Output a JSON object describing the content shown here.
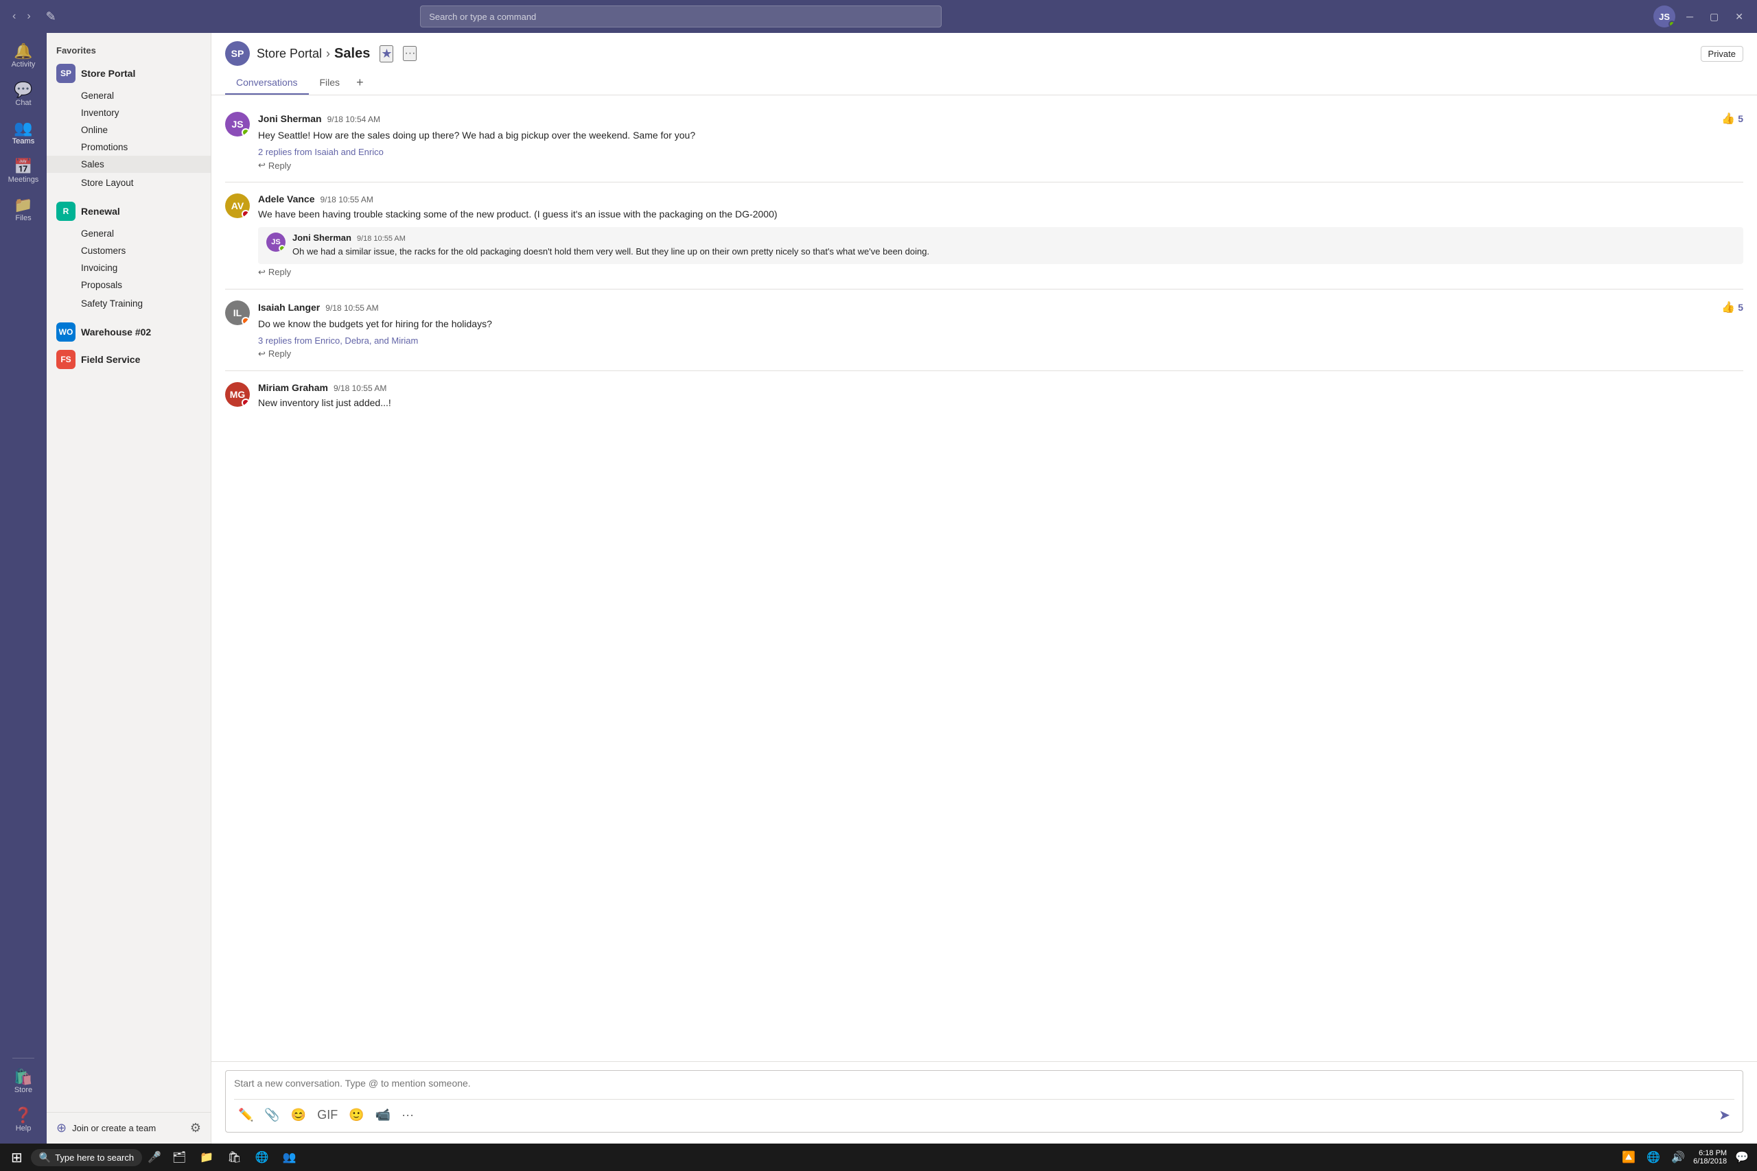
{
  "topbar": {
    "search_placeholder": "Search or type a command",
    "window_minimize": "─",
    "window_maximize": "▢",
    "window_close": "✕"
  },
  "nav_rail": {
    "items": [
      {
        "id": "activity",
        "label": "Activity",
        "icon": "🔔"
      },
      {
        "id": "chat",
        "label": "Chat",
        "icon": "💬"
      },
      {
        "id": "teams",
        "label": "Teams",
        "icon": "👥",
        "active": true
      },
      {
        "id": "meetings",
        "label": "Meetings",
        "icon": "📅"
      },
      {
        "id": "files",
        "label": "Files",
        "icon": "📁"
      },
      {
        "id": "store",
        "label": "Store",
        "icon": "🛍️"
      },
      {
        "id": "help",
        "label": "Help",
        "icon": "❓"
      }
    ]
  },
  "sidebar": {
    "favorites_label": "Favorites",
    "teams": [
      {
        "id": "store-portal",
        "name": "Store Portal",
        "avatar_text": "SP",
        "color": "#6264a7",
        "channels": [
          {
            "id": "general",
            "name": "General",
            "active": false
          },
          {
            "id": "inventory",
            "name": "Inventory",
            "active": false
          },
          {
            "id": "online",
            "name": "Online",
            "active": false
          },
          {
            "id": "promotions",
            "name": "Promotions",
            "active": false
          },
          {
            "id": "sales",
            "name": "Sales",
            "active": true
          },
          {
            "id": "store-layout",
            "name": "Store Layout",
            "active": false,
            "has_more": true
          }
        ]
      },
      {
        "id": "renewal",
        "name": "Renewal",
        "avatar_text": "R",
        "color": "#00b294",
        "channels": [
          {
            "id": "gen",
            "name": "General",
            "active": false
          },
          {
            "id": "customers",
            "name": "Customers",
            "active": false
          },
          {
            "id": "invoicing",
            "name": "Invoicing",
            "active": false
          },
          {
            "id": "proposals",
            "name": "Proposals",
            "active": false
          },
          {
            "id": "safety-training",
            "name": "Safety Training",
            "active": false,
            "has_more": true
          }
        ]
      },
      {
        "id": "warehouse",
        "name": "Warehouse #02",
        "avatar_text": "WO",
        "color": "#0078d4",
        "channels": [],
        "has_more": true
      },
      {
        "id": "field-service",
        "name": "Field Service",
        "avatar_text": "FS",
        "color": "#e74c3c",
        "channels": [],
        "has_more": true
      }
    ],
    "join_label": "Join or create a team"
  },
  "channel_header": {
    "team_name": "Store Portal",
    "channel_name": "Sales",
    "is_private": true,
    "private_label": "Private",
    "tabs": [
      {
        "id": "conversations",
        "label": "Conversations",
        "active": true
      },
      {
        "id": "files",
        "label": "Files",
        "active": false
      }
    ],
    "add_tab_label": "+"
  },
  "messages": [
    {
      "id": "msg1",
      "author": "Joni Sherman",
      "time": "9/18 10:54 AM",
      "text": "Hey Seattle! How are the sales doing up there? We had a big pickup over the weekend. Same for you?",
      "likes": 5,
      "replies_text": "2 replies from Isaiah and Enrico",
      "has_replies": true,
      "nested": null,
      "avatar_color": "#8b4db8",
      "status": "available"
    },
    {
      "id": "msg2",
      "author": "Adele Vance",
      "time": "9/18 10:55 AM",
      "text": "We have been having trouble stacking some of the new product. (I guess it's an issue with the packaging on the DG-2000)",
      "likes": 0,
      "has_replies": false,
      "nested": {
        "author": "Joni Sherman",
        "time": "9/18 10:55 AM",
        "text": "Oh we had a similar issue, the racks for the old packaging doesn't hold them very well. But they line up on their own pretty nicely so that's what we've been doing.",
        "avatar_color": "#8b4db8",
        "status": "available"
      },
      "avatar_color": "#c8a015",
      "status": "busy"
    },
    {
      "id": "msg3",
      "author": "Isaiah Langer",
      "time": "9/18 10:55 AM",
      "text": "Do we know the budgets yet for hiring for the holidays?",
      "likes": 5,
      "replies_text": "3 replies from Enrico, Debra, and Miriam",
      "has_replies": true,
      "nested": null,
      "avatar_color": "#7a7a7a",
      "status": "offline"
    },
    {
      "id": "msg4",
      "author": "Miriam Graham",
      "time": "9/18 10:55 AM",
      "text": "New inventory list just added...!",
      "likes": 0,
      "has_replies": false,
      "nested": null,
      "avatar_color": "#c0392b",
      "status": "busy"
    }
  ],
  "compose": {
    "placeholder": "Start a new conversation. Type @ to mention someone."
  },
  "taskbar": {
    "search_placeholder": "Type here to search",
    "time": "6:18 PM",
    "date": "6/18/2018"
  }
}
